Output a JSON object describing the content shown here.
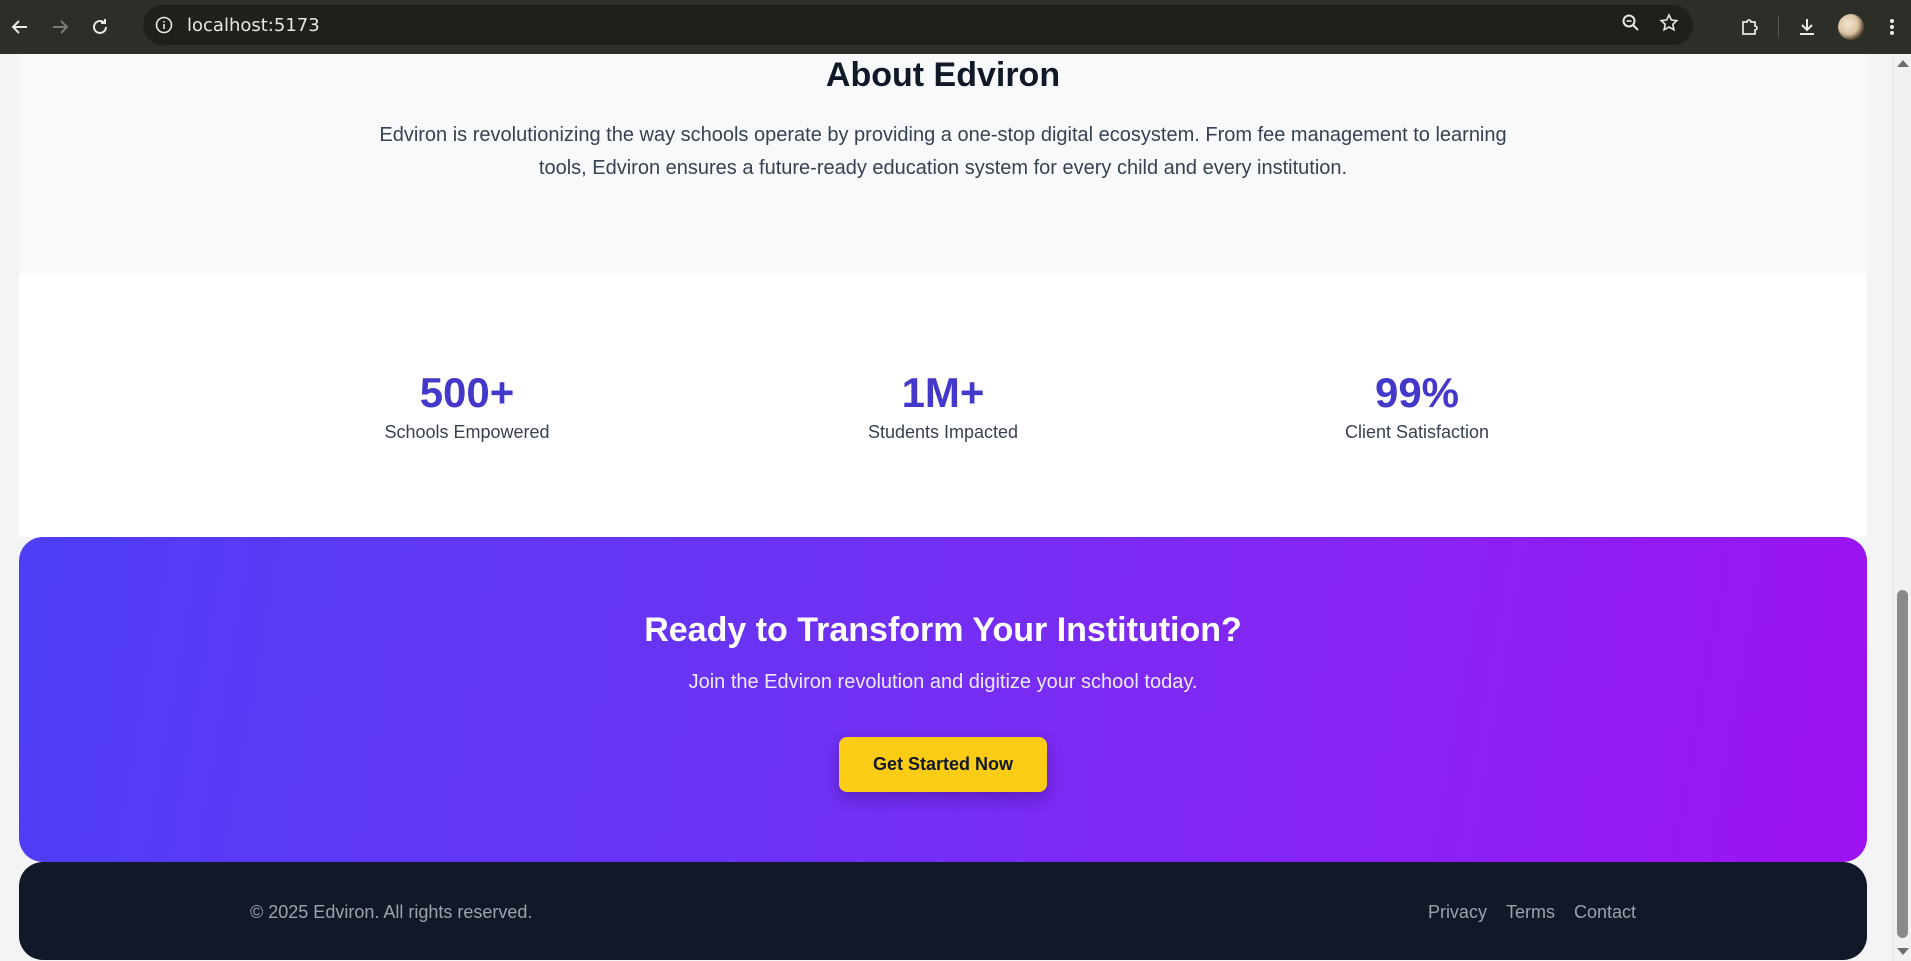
{
  "browser": {
    "url": "localhost:5173",
    "back_icon": "arrow-left-icon",
    "forward_icon": "arrow-right-icon",
    "reload_icon": "reload-icon",
    "site_info_icon": "info-icon",
    "zoom_icon": "zoom-icon",
    "bookmark_icon": "star-icon",
    "extensions_icon": "puzzle-icon",
    "downloads_icon": "download-icon",
    "menu_icon": "kebab-menu-icon"
  },
  "about": {
    "title": "About Edviron",
    "description": "Edviron is revolutionizing the way schools operate by providing a one-stop digital ecosystem. From fee management to learning tools, Edviron ensures a future-ready education system for every child and every institution."
  },
  "stats": [
    {
      "value": "500+",
      "label": "Schools Empowered"
    },
    {
      "value": "1M+",
      "label": "Students Impacted"
    },
    {
      "value": "99%",
      "label": "Client Satisfaction"
    }
  ],
  "cta": {
    "title": "Ready to Transform Your Institution?",
    "subtitle": "Join the Edviron revolution and digitize your school today.",
    "button_label": "Get Started Now"
  },
  "footer": {
    "copyright": "© 2025 Edviron. All rights reserved.",
    "links": [
      "Privacy",
      "Terms",
      "Contact"
    ]
  },
  "colors": {
    "accent": "#4338ca",
    "cta_gradient_start": "#4f3ef6",
    "cta_gradient_end": "#9d12f2",
    "button": "#facc15",
    "footer": "#111827"
  }
}
